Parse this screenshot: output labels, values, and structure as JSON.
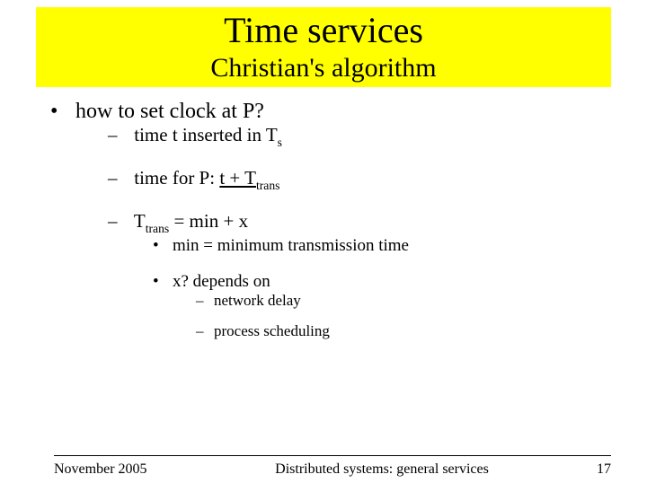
{
  "title": "Time services",
  "subtitle": "Christian's algorithm",
  "bullets": {
    "main": "how to set clock at P?",
    "l2a_pre": "time t inserted in T",
    "l2a_sub": "s",
    "l2b_pre": "time for P: ",
    "l2b_u": "t + T",
    "l2b_sub": "trans",
    "l2c_pre": "T",
    "l2c_sub": "trans",
    "l2c_post": " = min + x",
    "l3a": "min = minimum transmission time",
    "l3b": "x? depends on",
    "l4a": "network delay",
    "l4b": "process scheduling"
  },
  "footer": {
    "date": "November 2005",
    "source": "Distributed systems: general services",
    "page": "17"
  }
}
